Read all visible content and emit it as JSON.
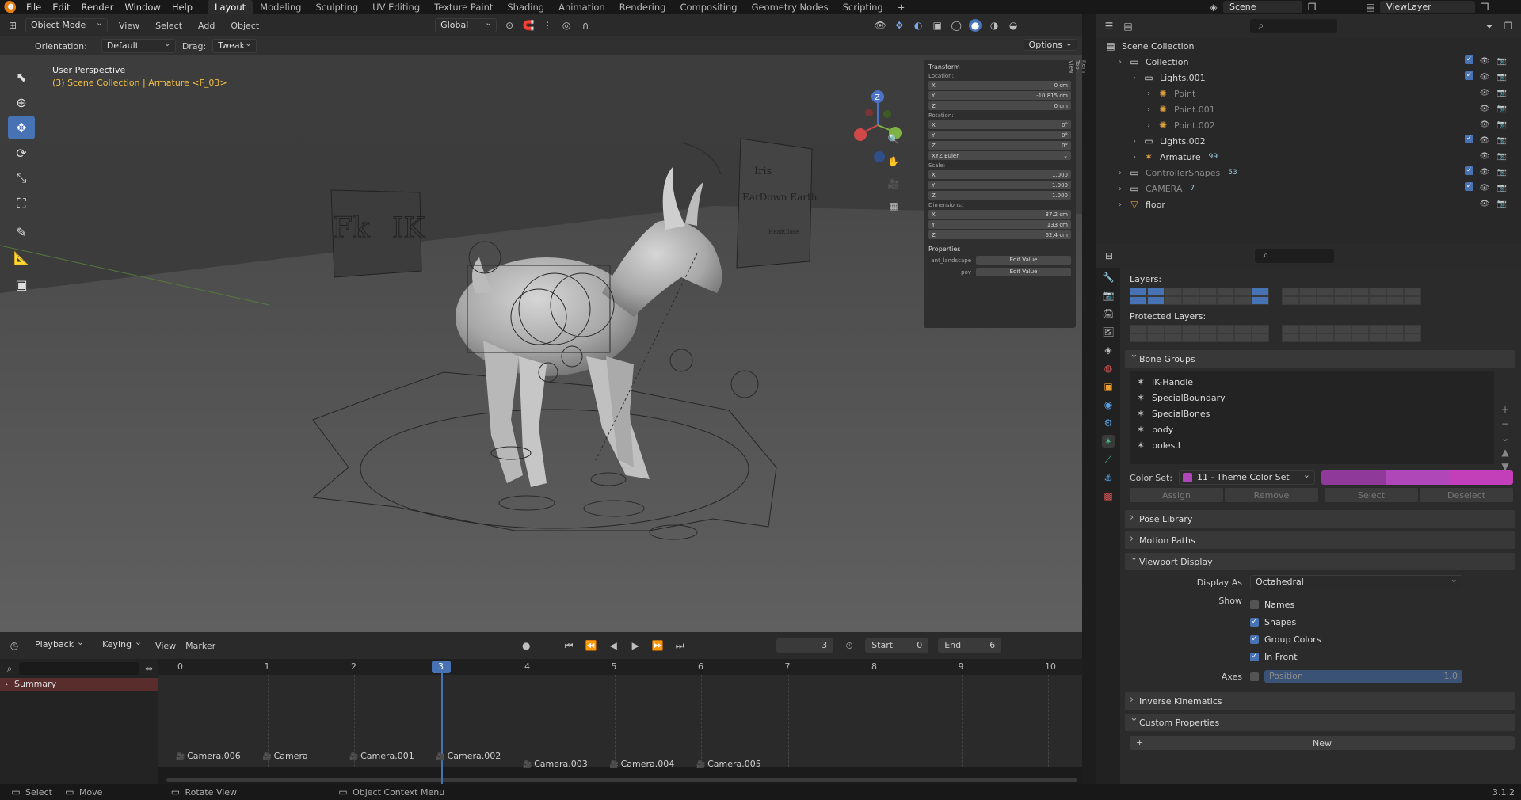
{
  "menubar": {
    "items": [
      "File",
      "Edit",
      "Render",
      "Window",
      "Help"
    ],
    "workspaces": [
      "Layout",
      "Modeling",
      "Sculpting",
      "UV Editing",
      "Texture Paint",
      "Shading",
      "Animation",
      "Rendering",
      "Compositing",
      "Geometry Nodes",
      "Scripting"
    ],
    "active_workspace": "Layout",
    "add_tab": "+",
    "scene_label": "Scene",
    "viewlayer_label": "ViewLayer"
  },
  "viewport_header": {
    "mode": "Object Mode",
    "menus": [
      "View",
      "Select",
      "Add",
      "Object"
    ],
    "transform_space": "Global",
    "options_label": "Options"
  },
  "tool_settings": {
    "orientation_label": "Orientation:",
    "orientation_value": "Default",
    "drag_label": "Drag:",
    "drag_value": "Tweak"
  },
  "viewport": {
    "view_name": "User Perspective",
    "context": "(3) Scene Collection | Armature <F_03>",
    "board_fk": "Fk",
    "board_ik": "IK",
    "board2_lines": [
      "Iris",
      "EarDown Earth",
      "HeadClose"
    ]
  },
  "n_panel": {
    "transform_title": "Transform",
    "location_label": "Location:",
    "location": [
      {
        "axis": "X",
        "value": "0 cm"
      },
      {
        "axis": "Y",
        "value": "-10.815 cm"
      },
      {
        "axis": "Z",
        "value": "0 cm"
      }
    ],
    "rotation_label": "Rotation:",
    "rotation": [
      {
        "axis": "X",
        "value": "0°"
      },
      {
        "axis": "Y",
        "value": "0°"
      },
      {
        "axis": "Z",
        "value": "0°"
      }
    ],
    "rotation_mode": "XYZ Euler",
    "scale_label": "Scale:",
    "scale": [
      {
        "axis": "X",
        "value": "1.000"
      },
      {
        "axis": "Y",
        "value": "1.000"
      },
      {
        "axis": "Z",
        "value": "1.000"
      }
    ],
    "dimensions_label": "Dimensions:",
    "dimensions": [
      {
        "axis": "X",
        "value": "37.2 cm"
      },
      {
        "axis": "Y",
        "value": "133 cm"
      },
      {
        "axis": "Z",
        "value": "62.4 cm"
      }
    ],
    "properties_title": "Properties",
    "props": [
      {
        "name": "ant_landscape",
        "button": "Edit Value"
      },
      {
        "name": "pov",
        "button": "Edit Value"
      }
    ],
    "tabs": [
      "Item",
      "Tool",
      "View"
    ]
  },
  "outliner": {
    "rows": [
      {
        "label": "Scene Collection",
        "indent": 0,
        "icon": "scene-collection-icon"
      },
      {
        "label": "Collection",
        "indent": 1,
        "icon": "collection-icon"
      },
      {
        "label": "Lights.001",
        "indent": 2,
        "icon": "collection-icon"
      },
      {
        "label": "Point",
        "indent": 3,
        "icon": "light-icon",
        "dim": true
      },
      {
        "label": "Point.001",
        "indent": 3,
        "icon": "light-icon",
        "dim": true
      },
      {
        "label": "Point.002",
        "indent": 3,
        "icon": "light-icon",
        "dim": true
      },
      {
        "label": "Lights.002",
        "indent": 2,
        "icon": "collection-icon"
      },
      {
        "label": "Armature",
        "indent": 2,
        "icon": "armature-icon",
        "badge": "99"
      },
      {
        "label": "ControllerShapes",
        "indent": 1,
        "icon": "collection-icon",
        "dim": true,
        "badge": "53"
      },
      {
        "label": "CAMERA",
        "indent": 1,
        "icon": "collection-icon",
        "dim": true,
        "badge": "7"
      },
      {
        "label": "floor",
        "indent": 1,
        "icon": "mesh-icon"
      }
    ]
  },
  "properties": {
    "layers_label": "Layers:",
    "protected_label": "Protected Layers:",
    "bone_groups_title": "Bone Groups",
    "bone_groups": [
      "IK-Handle",
      "SpecialBoundary",
      "SpecialBones",
      "body",
      "poles.L"
    ],
    "color_set_label": "Color Set:",
    "color_set_value": "11 - Theme Color Set",
    "color_swatches": [
      "#8f3a9a",
      "#b047b8",
      "#c23fb9"
    ],
    "group_buttons": [
      "Assign",
      "Remove",
      "Select",
      "Deselect"
    ],
    "collapsed_panels": [
      "Pose Library",
      "Motion Paths"
    ],
    "viewport_display_title": "Viewport Display",
    "display_as_label": "Display As",
    "display_as_value": "Octahedral",
    "show_label": "Show",
    "show_options": [
      {
        "label": "Names",
        "checked": false
      },
      {
        "label": "Shapes",
        "checked": true
      },
      {
        "label": "Group Colors",
        "checked": true
      },
      {
        "label": "In Front",
        "checked": true
      }
    ],
    "axes_label": "Axes",
    "axes_position_label": "Position",
    "axes_position_value": "1.0",
    "ik_title": "Inverse Kinematics",
    "custom_props_title": "Custom Properties",
    "new_button": "New"
  },
  "timeline": {
    "menus": [
      "Playback",
      "Keying",
      "View",
      "Marker"
    ],
    "current_frame": "3",
    "start_label": "Start",
    "start_value": "0",
    "end_label": "End",
    "end_value": "6",
    "ticks": [
      "0",
      "1",
      "2",
      "3",
      "4",
      "5",
      "6",
      "7",
      "8",
      "9",
      "10"
    ],
    "summary_label": "Summary",
    "markers": [
      {
        "name": "Camera.006",
        "frame": 0
      },
      {
        "name": "Camera",
        "frame": 1
      },
      {
        "name": "Camera.001",
        "frame": 2
      },
      {
        "name": "Camera.002",
        "frame": 3
      },
      {
        "name": "Camera.003",
        "frame": 4
      },
      {
        "name": "Camera.004",
        "frame": 5
      },
      {
        "name": "Camera.005",
        "frame": 6
      }
    ]
  },
  "statusbar": {
    "items": [
      "Select",
      "Move",
      "Rotate View",
      "Object Context Menu"
    ],
    "version": "3.1.2"
  }
}
